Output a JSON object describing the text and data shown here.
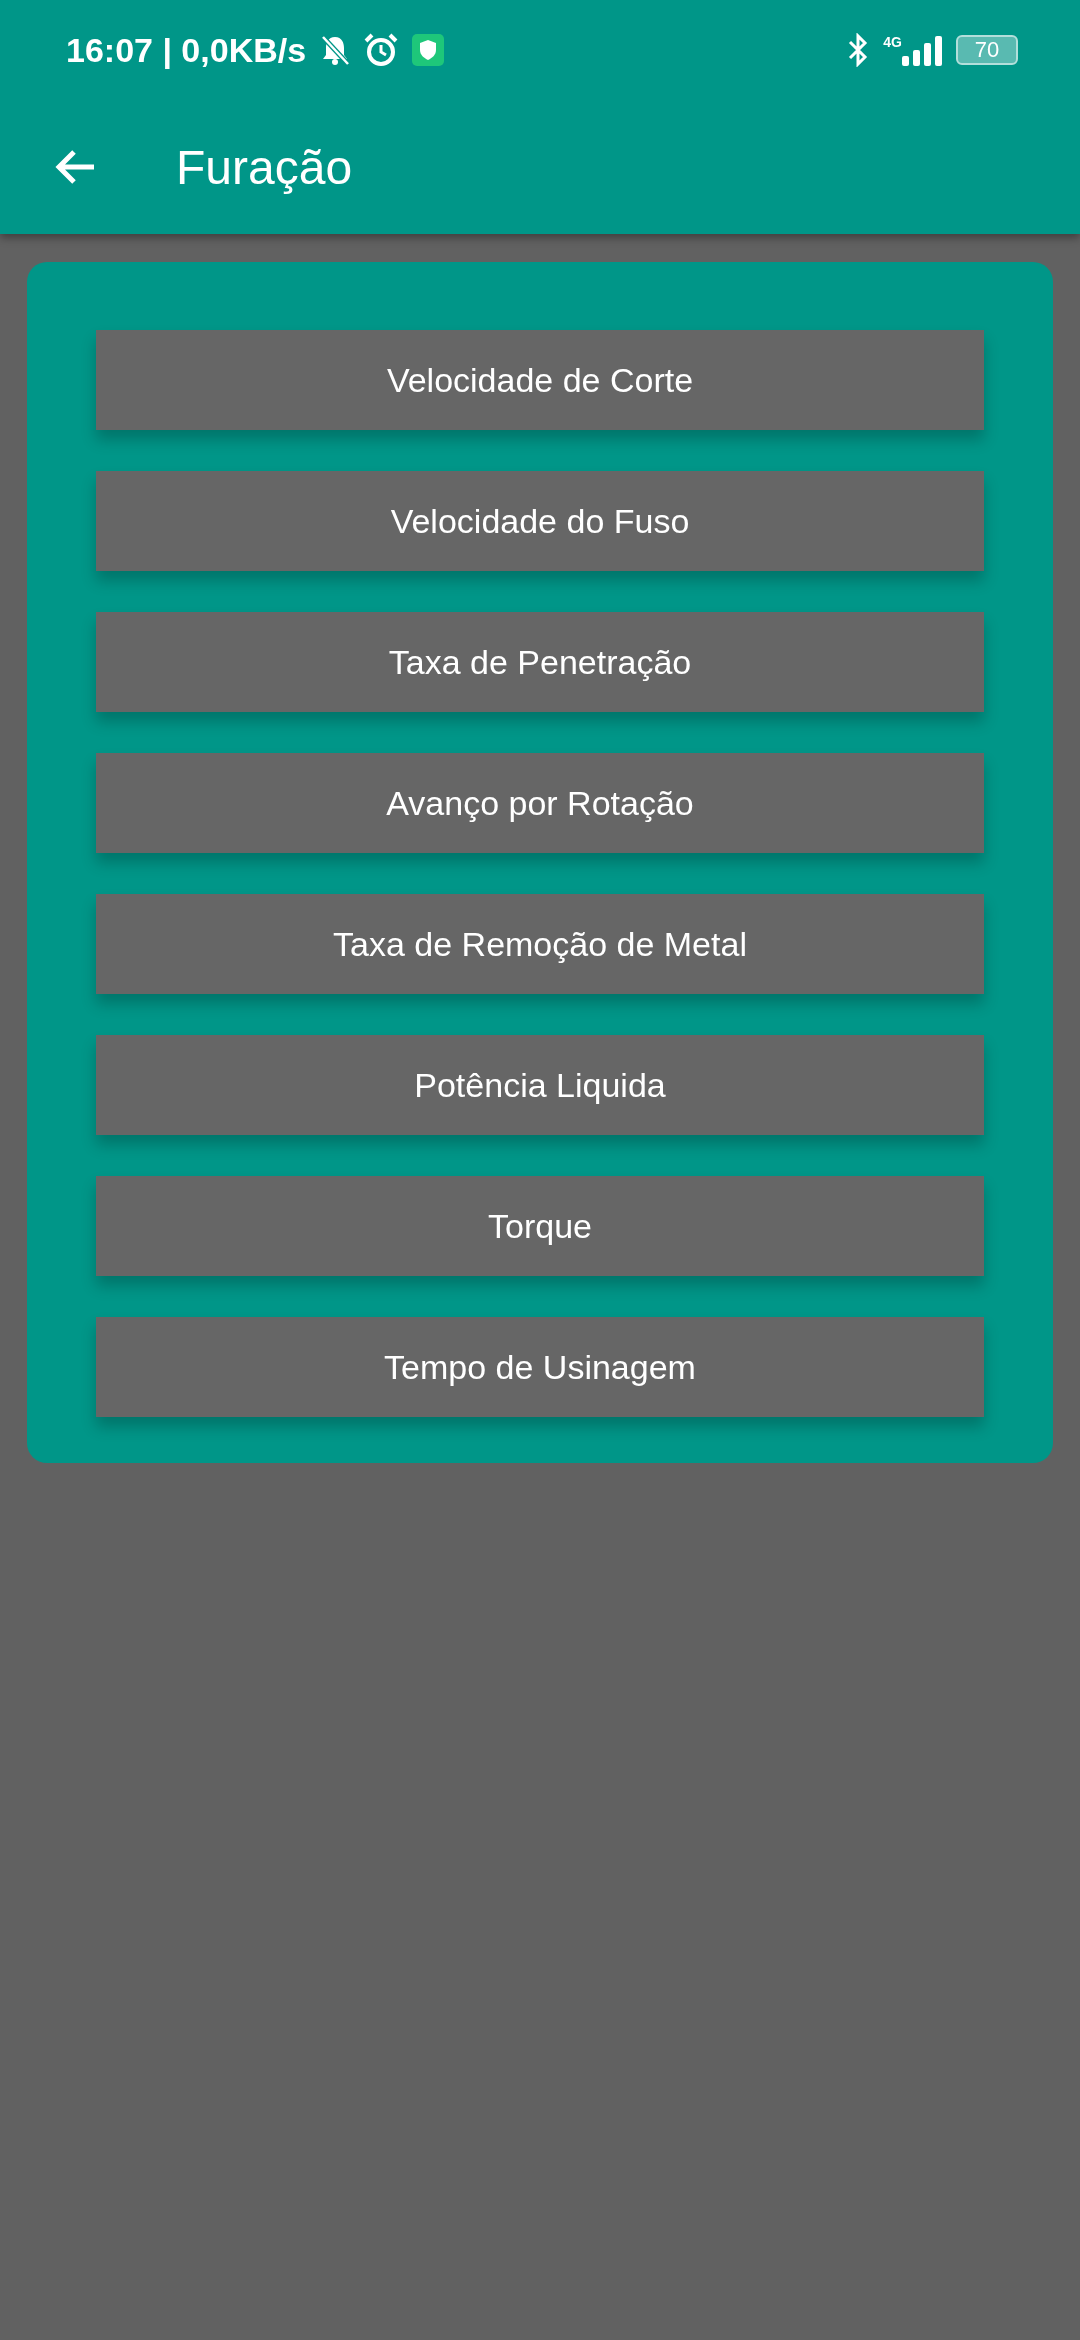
{
  "status_bar": {
    "time": "16:07 | 0,0KB/s",
    "network": "4G",
    "battery": "70"
  },
  "toolbar": {
    "title": "Furação"
  },
  "buttons": [
    {
      "label": "Velocidade de Corte"
    },
    {
      "label": "Velocidade do Fuso"
    },
    {
      "label": "Taxa de Penetração"
    },
    {
      "label": "Avanço por Rotação"
    },
    {
      "label": "Taxa de Remoção de Metal"
    },
    {
      "label": "Potência Liquida"
    },
    {
      "label": "Torque"
    },
    {
      "label": "Tempo de Usinagem"
    }
  ]
}
